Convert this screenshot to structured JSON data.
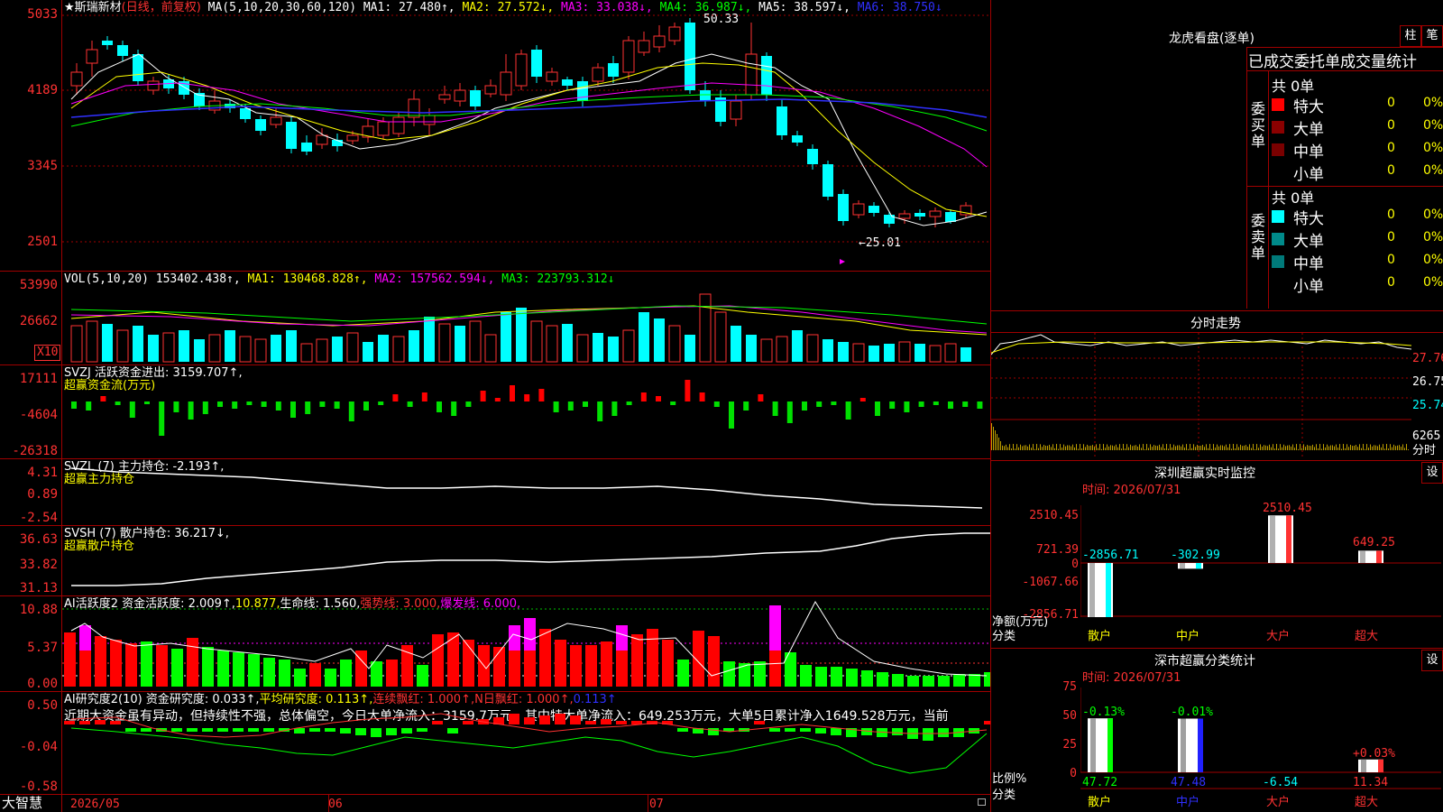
{
  "stock": {
    "star": "★",
    "name": "斯瑞新材",
    "period": "(日线，前复权)"
  },
  "kline": {
    "ma_params": "MA(5,10,20,30,60,120)",
    "ma1": "MA1: 27.480↑,",
    "ma2": "MA2: 27.572↓,",
    "ma3": "MA3: 33.038↓,",
    "ma4": "MA4: 36.987↓,",
    "ma5": "MA5: 38.597↓,",
    "ma6": "MA6: 38.750↓",
    "yticks": [
      "5033",
      "4189",
      "3345",
      "2501"
    ],
    "high_label": "50.33",
    "low_label": "←25.01"
  },
  "vol": {
    "header": "VOL(5,10,20)",
    "value": "153402.438↑,",
    "ma1": "MA1: 130468.828↑,",
    "ma2": "MA2: 157562.594↓,",
    "ma3": "MA3: 223793.312↓",
    "yticks": [
      "53990",
      "26662"
    ],
    "unit": "X10"
  },
  "svzj": {
    "header": "SVZJ  活跃资金进出: 3159.707↑,",
    "sub": "超赢资金流(万元)",
    "yticks": [
      "17111",
      "-4604",
      "-26318"
    ]
  },
  "svzl": {
    "header": "SVZL (7) 主力持仓: -2.193↑,",
    "sub": "超赢主力持仓",
    "yticks": [
      "4.31",
      "0.89",
      "-2.54"
    ]
  },
  "svsh": {
    "header": "SVSH (7) 散户持仓: 36.217↓,",
    "sub": "超赢散户持仓",
    "yticks": [
      "36.63",
      "33.82",
      "31.13"
    ]
  },
  "ai1": {
    "h1": "AI活跃度2 资金活跃度: 2.009↑,",
    "h2": "10.877,",
    "h3": "生命线: 1.560,",
    "h4": "强势线: 3.000,",
    "h5": "爆发线: 6.000,",
    "yticks": [
      "10.88",
      "5.37",
      "0.00"
    ]
  },
  "ai2": {
    "h1": "AI研究度2(10) 资金研究度: 0.033↑,",
    "h2": "平均研究度: 0.113↑,",
    "h3": "连续飘红: 1.000↑,",
    "h4": "N日飘红: 1.000↑,",
    "h5": "0.113↑",
    "note": "近期大资金虽有异动，但持续性不强，总体偏空，今日大单净流入：3159.7万元，其中特大单净流入：649.253万元，大单5日累计净入1649.528万元，当前",
    "yticks": [
      "0.50",
      "-0.04",
      "-0.58"
    ]
  },
  "xaxis": {
    "brand": "大智慧",
    "labels": [
      "2026/05",
      "06",
      "07"
    ]
  },
  "lhb": {
    "title": "龙虎看盘(逐单)",
    "btn1": "柱",
    "btn2": "笔",
    "tabs": "已成交委托单成交量统计",
    "buy_label": "委买单",
    "sell_label": "委卖单",
    "buy_total": "共 0单",
    "sell_total": "共 0单",
    "buy_rows": [
      {
        "name": "特大",
        "n": "0",
        "p": "0%",
        "color": "#ff0000"
      },
      {
        "name": "大单",
        "n": "0",
        "p": "0%",
        "color": "#8b0000"
      },
      {
        "name": "中单",
        "n": "0",
        "p": "0%",
        "color": "#7a0000"
      },
      {
        "name": "小单",
        "n": "0",
        "p": "0%",
        "color": "#000000"
      }
    ],
    "sell_rows": [
      {
        "name": "特大",
        "n": "0",
        "p": "0%",
        "color": "#00ffff"
      },
      {
        "name": "大单",
        "n": "0",
        "p": "0%",
        "color": "#008b8b"
      },
      {
        "name": "中单",
        "n": "0",
        "p": "0%",
        "color": "#007a7a"
      },
      {
        "name": "小单",
        "n": "0",
        "p": "0%",
        "color": "#000000"
      }
    ]
  },
  "fenshi": {
    "title": "分时走势",
    "yticks": [
      "27.76",
      "26.75",
      "25.74"
    ],
    "vol": "6265",
    "vol_unit": "分时"
  },
  "sz1": {
    "title": "深圳超赢实时监控",
    "btn": "设",
    "time": "时间: 2026/07/31",
    "yticks": [
      "2510.45",
      "721.39",
      "0",
      "-1067.66",
      "-2856.71"
    ],
    "bar_vals": [
      "-2856.71",
      "-302.99",
      "2510.45",
      "649.25"
    ],
    "cats": [
      "散户",
      "中户",
      "大户",
      "超大"
    ],
    "yname": "净额(万元)",
    "xname": "分类"
  },
  "sz2": {
    "title": "深市超赢分类统计",
    "btn": "设",
    "time": "时间: 2026/07/31",
    "yticks": [
      "75",
      "50",
      "25",
      "0"
    ],
    "top_vals": [
      "-0.13%",
      "-0.01%",
      "",
      "+0.03%"
    ],
    "bottom_vals": [
      "47.72",
      "47.48",
      "-6.54",
      "11.34"
    ],
    "cats": [
      "散户",
      "中户",
      "大户",
      "超大"
    ],
    "yname": "比例%",
    "xname": "分类"
  }
}
